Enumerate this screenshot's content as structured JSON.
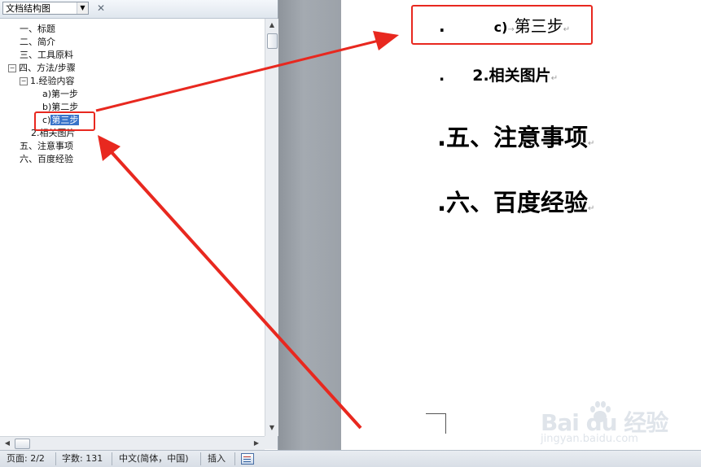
{
  "nav_pane": {
    "dropdown_value": "文档结构图",
    "tree": [
      {
        "label": "一、标题",
        "level": 0,
        "toggle": ""
      },
      {
        "label": "二、简介",
        "level": 0,
        "toggle": ""
      },
      {
        "label": "三、工具原料",
        "level": 0,
        "toggle": ""
      },
      {
        "label": "四、方法/步骤",
        "level": 0,
        "toggle": "⊟"
      },
      {
        "label": "1.经验内容",
        "level": 1,
        "toggle": "⊟"
      },
      {
        "label": "a)第一步",
        "level": 2,
        "toggle": ""
      },
      {
        "label": "b)第二步",
        "level": 2,
        "toggle": ""
      },
      {
        "prefix": "c)",
        "label": "第三步",
        "level": 2,
        "toggle": "",
        "selected": true
      },
      {
        "label": "2.相关图片",
        "level": 1,
        "toggle": ""
      },
      {
        "label": "五、注意事项",
        "level": 0,
        "toggle": ""
      },
      {
        "label": "六、百度经验",
        "level": 0,
        "toggle": ""
      }
    ]
  },
  "document": {
    "lines": [
      {
        "bullet": ".",
        "prefix": "c)",
        "text": "第三步",
        "mark": "↵"
      },
      {
        "bullet": ".",
        "prefix": "2.",
        "text": "相关图片",
        "mark": "↵"
      },
      {
        "bullet": ".",
        "text": "五、注意事项",
        "mark": "↵"
      },
      {
        "bullet": ".",
        "text": "六、百度经验",
        "mark": "↵"
      }
    ]
  },
  "status_bar": {
    "page": "页面: 2/2",
    "words": "字数: 131",
    "language": "中文(简体，中国)",
    "mode": "插入"
  },
  "watermark": {
    "brand": "Bai du 经验",
    "site": "jingyan.baidu.com"
  },
  "colors": {
    "highlight_red": "#e8281f",
    "selection_blue": "#3873c9",
    "gutter_gray": "#9ca2a9"
  }
}
